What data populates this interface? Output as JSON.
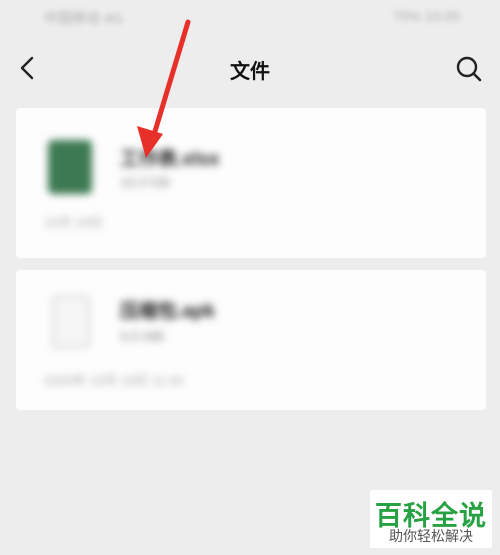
{
  "status_bar": {
    "left": "中国移动 4G",
    "right": "70% 10:00"
  },
  "nav": {
    "title": "文件",
    "back_icon": "chevron-left-icon",
    "search_icon": "search-icon"
  },
  "files": [
    {
      "icon": "excel-file-icon",
      "icon_color": "#3d7a53",
      "name": "工作表.xlsx",
      "size": "10.0 KB",
      "time": "10月 19日"
    },
    {
      "icon": "blank-file-icon",
      "name": "压缩包.apk",
      "size": "9.5 MB",
      "time": "2020年 10月 19日 11:34"
    }
  ],
  "annotation": {
    "arrow_color": "#e8302a"
  },
  "watermark": {
    "title": "百科全说",
    "subtitle": "助你轻松解决",
    "color": "#27a243"
  }
}
